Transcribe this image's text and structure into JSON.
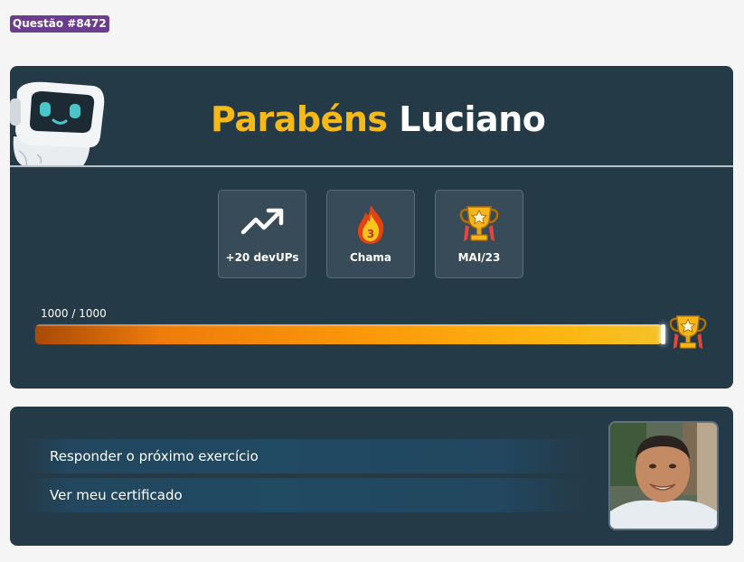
{
  "question_badge": "Questão #8472",
  "header": {
    "greeting": "Parabéns",
    "name": "Luciano"
  },
  "stats": [
    {
      "icon": "trending-up-icon",
      "label": "+20 devUPs"
    },
    {
      "icon": "flame-icon",
      "label": "Chama",
      "count": "3"
    },
    {
      "icon": "trophy-icon",
      "label": "MAI/23"
    }
  ],
  "progress": {
    "label": "1000 / 1000",
    "current": 1000,
    "max": 1000
  },
  "actions": [
    {
      "label": "Responder o próximo exercício"
    },
    {
      "label": "Ver meu certificado"
    }
  ],
  "colors": {
    "accent": "#f7b916",
    "card": "#253a47",
    "badge": "#6c3d8f"
  }
}
